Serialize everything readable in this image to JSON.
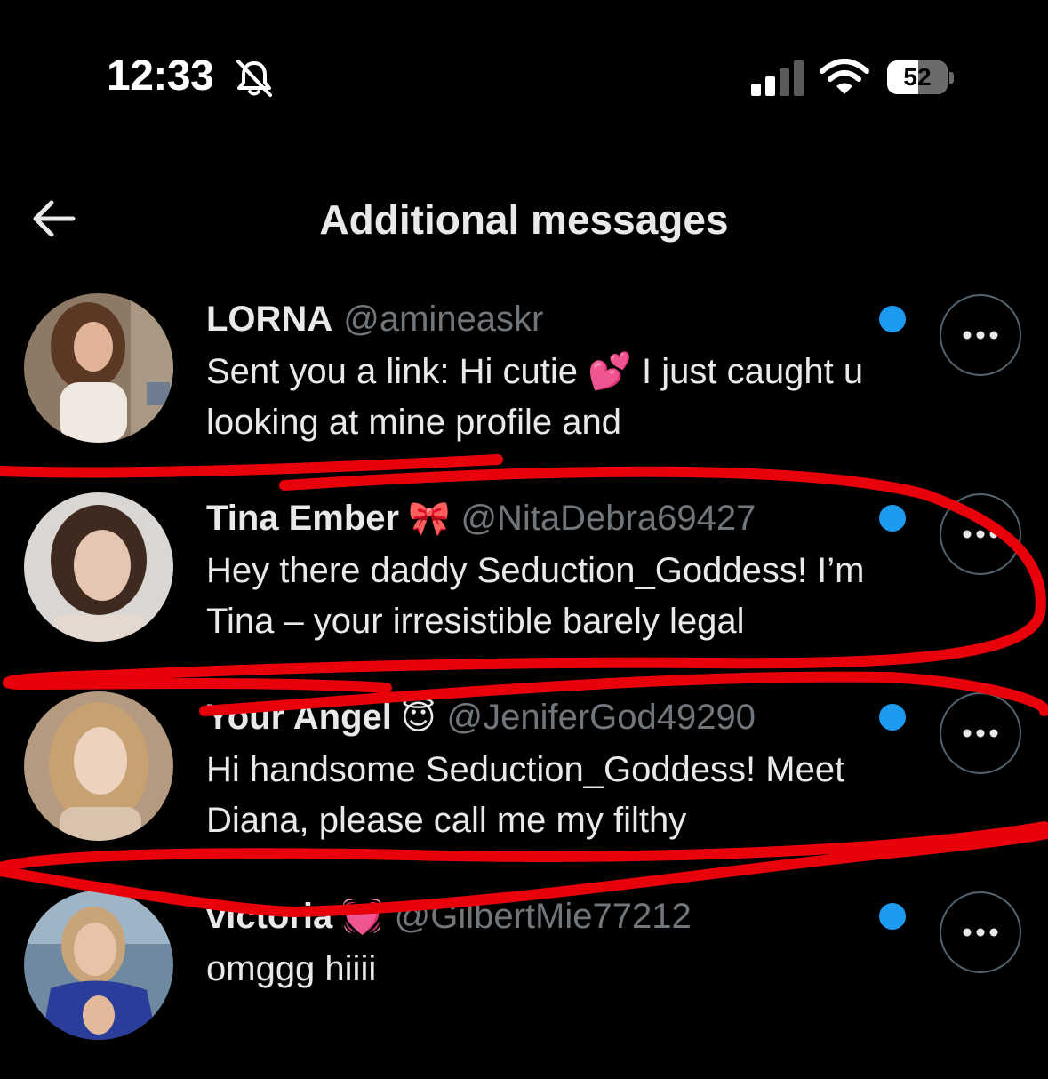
{
  "status_bar": {
    "time": "12:33",
    "battery": "52",
    "battery_level": 0.52,
    "icons": [
      "bell-slash-icon",
      "cellular-signal-icon",
      "wifi-icon",
      "battery-icon"
    ]
  },
  "header": {
    "back_icon": "arrow-left-icon",
    "title": "Additional messages"
  },
  "colors": {
    "background": "#000000",
    "text_primary": "#e7e9ea",
    "text_secondary": "#71767b",
    "unread_dot": "#1d9bf0",
    "annotation_marker": "#e8000b"
  },
  "messages": [
    {
      "name": "LORNA",
      "emoji": "",
      "handle": "@amineaskr",
      "preview": "Sent you a link: Hi cutie 💕 I just caught u looking at mine profile and",
      "unread": true
    },
    {
      "name": "Tina Ember",
      "emoji": "🎀",
      "handle": "@NitaDebra69427",
      "preview": "Hey there daddy Seduction_Goddess! I’m Tina – your irresistible barely legal",
      "unread": true
    },
    {
      "name": "Your Angel",
      "emoji": "😇",
      "handle": "@JeniferGod49290",
      "preview": "Hi handsome Seduction_Goddess! Meet Diana, please call me my filthy",
      "unread": true
    },
    {
      "name": "victoria",
      "emoji": "💓",
      "handle": "@GilbertMie77212",
      "preview": "omggg hiiii",
      "unread": true
    }
  ]
}
